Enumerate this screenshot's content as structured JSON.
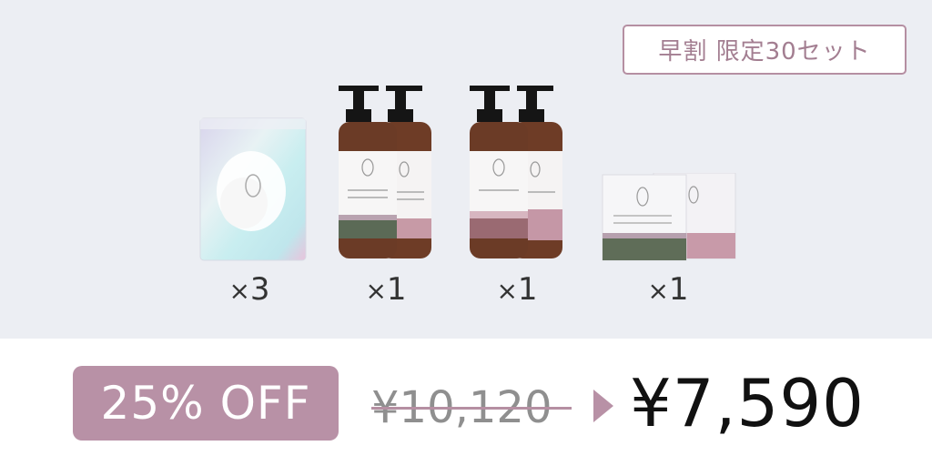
{
  "badge": {
    "text": "早割 限定30セット"
  },
  "products": [
    {
      "name": "sponge-pouch",
      "qty": "3"
    },
    {
      "name": "pump-bottles-set-a",
      "qty": "1"
    },
    {
      "name": "pump-bottles-set-b",
      "qty": "1"
    },
    {
      "name": "soap-boxes",
      "qty": "1"
    }
  ],
  "qty_prefix": "×",
  "discount": {
    "label": "25% OFF"
  },
  "price": {
    "original": "¥10,120",
    "sale": "¥7,590"
  },
  "colors": {
    "accent": "#b891a6",
    "panel_bg": "#eceef3",
    "amber": "#6b3b26"
  }
}
